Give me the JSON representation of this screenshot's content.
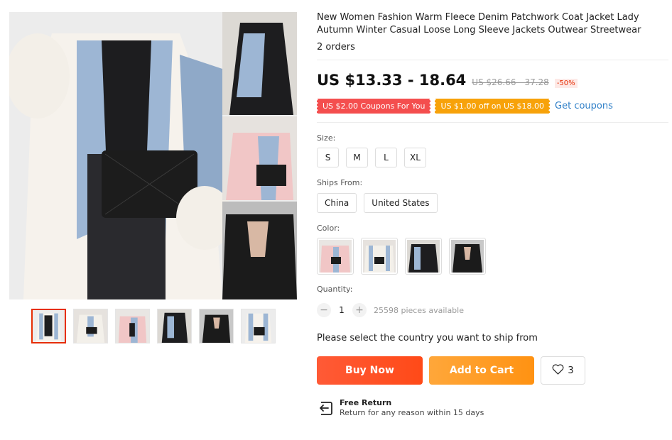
{
  "product": {
    "title": "New Women Fashion Warm Fleece Denim Patchwork Coat Jacket Lady Autumn Winter Casual Loose Long Sleeve Jackets Outwear Streetwear",
    "orders": "2 orders"
  },
  "price": {
    "current": "US $13.33 - 18.64",
    "original": "US $26.66 - 37.28",
    "discount": "-50%"
  },
  "coupons": {
    "coupon1": "US $2.00 Coupons For You",
    "coupon2": "US $1.00 off on US $18.00",
    "get_coupons": "Get coupons"
  },
  "size": {
    "label": "Size:",
    "options": [
      "S",
      "M",
      "L",
      "XL"
    ]
  },
  "ships_from": {
    "label": "Ships From:",
    "options": [
      "China",
      "United States"
    ]
  },
  "color": {
    "label": "Color:",
    "swatches": [
      "white-pink fleece denim",
      "white fleece denim",
      "black denim blue",
      "black fleece"
    ]
  },
  "quantity": {
    "label": "Quantity:",
    "minus": "−",
    "value": "1",
    "plus": "+",
    "available": "25598 pieces available"
  },
  "ship_note": "Please select the country you want to ship from",
  "buttons": {
    "buy_now": "Buy Now",
    "add_to_cart": "Add to Cart",
    "wishlist_count": "3"
  },
  "free_return": {
    "title": "Free Return",
    "desc": "Return for any reason within 15 days"
  },
  "gallery": {
    "thumbnails": 6,
    "active_thumbnail": 1
  },
  "icons": {
    "wishlist": "heart-icon",
    "return": "return-arrow-icon"
  },
  "colors": {
    "accent_red": "#f44e4e",
    "accent_orange": "#f7a20a",
    "link": "#2f7fc7",
    "buy": "#ff4a18",
    "cart": "#ff9212"
  }
}
